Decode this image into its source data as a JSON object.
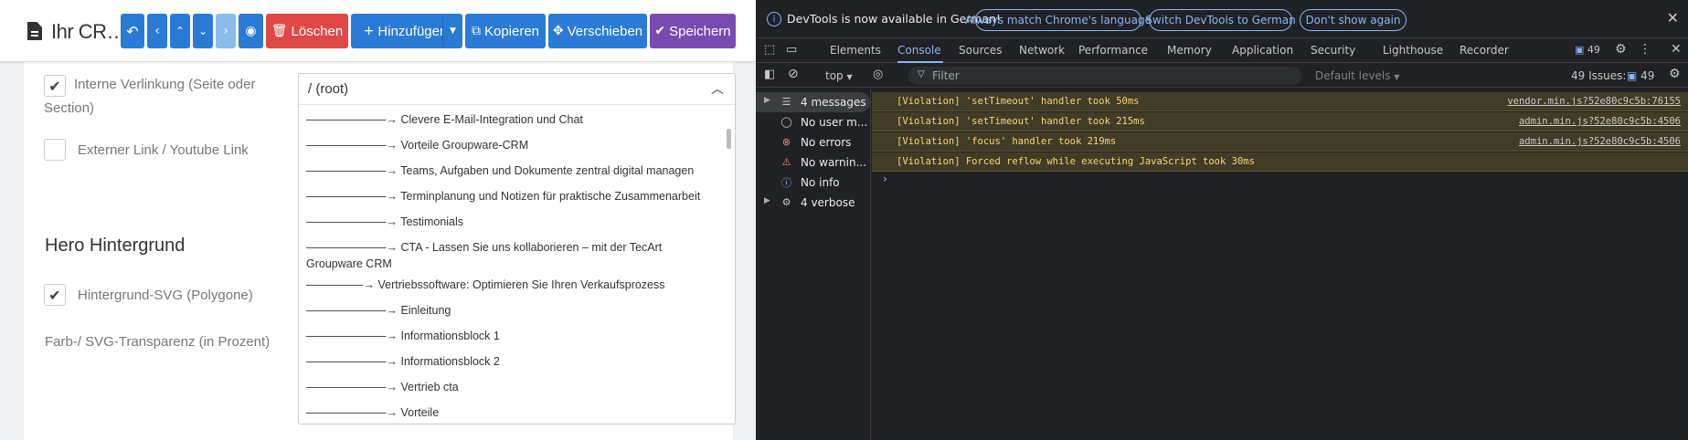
{
  "header": {
    "title": "Ihr CR…",
    "buttons": {
      "delete": "Löschen",
      "add": "Hinzufügen",
      "copy": "Kopieren",
      "move": "Verschieben",
      "save": "Speichern"
    }
  },
  "form": {
    "internal_link_label": "Interne Verlinkung (Seite oder Section)",
    "external_link_label": "Externer Link / Youtube Link",
    "hero_heading": "Hero Hintergrund",
    "hero_svg_label": "Hintergrund-SVG (Polygone)",
    "transparency_label": "Farb-/ SVG-Transparenz (in Prozent)",
    "select_value": "/ (root)",
    "options": [
      "———————→ Clevere E-Mail-Integration und Chat",
      "———————→ Vorteile Groupware-CRM",
      "———————→ Teams, Aufgaben und Dokumente zentral digital managen",
      "———————→ Terminplanung und Notizen für praktische Zusammenarbeit",
      "———————→ Testimonials",
      "———————→ CTA - Lassen Sie uns kollaborieren – mit der TecArt Groupware CRM",
      "—————→ Vertriebssoftware: Optimieren Sie Ihren Verkaufsprozess",
      "———————→ Einleitung",
      "———————→ Informationsblock 1",
      "———————→ Informationsblock 2",
      "———————→ Vertrieb cta",
      "———————→ Vorteile"
    ]
  },
  "devtools": {
    "banner": {
      "message": "DevTools is now available in German!",
      "btn_match": "Always match Chrome's language",
      "btn_switch": "Switch DevTools to German",
      "btn_dismiss": "Don't show again"
    },
    "tabs": [
      "Elements",
      "Console",
      "Sources",
      "Network",
      "Performance",
      "Memory",
      "Application",
      "Security",
      "Lighthouse",
      "Recorder"
    ],
    "issues_count": "49",
    "filter": {
      "context": "top",
      "placeholder": "Filter",
      "levels": "Default levels",
      "issues_label": "49 Issues:",
      "issues_badge": "49"
    },
    "sidebar": [
      {
        "label": "4 messages",
        "icon": "list-icon"
      },
      {
        "label": "No user m...",
        "icon": "user-icon"
      },
      {
        "label": "No errors",
        "icon": "error-icon"
      },
      {
        "label": "No warnin...",
        "icon": "warning-icon"
      },
      {
        "label": "No info",
        "icon": "info-icon"
      },
      {
        "label": "4 verbose",
        "icon": "bug-icon"
      }
    ],
    "messages": [
      {
        "text": "[Violation] 'setTimeout' handler took 50ms",
        "source": "vendor.min.js?52e80c9c5b:76155"
      },
      {
        "text": "[Violation] 'setTimeout' handler took 215ms",
        "source": "admin.min.js?52e80c9c5b:4506"
      },
      {
        "text": "[Violation] 'focus' handler took 219ms",
        "source": "admin.min.js?52e80c9c5b:4506"
      },
      {
        "text": "[Violation] Forced reflow while executing JavaScript took 30ms",
        "source": ""
      }
    ]
  }
}
